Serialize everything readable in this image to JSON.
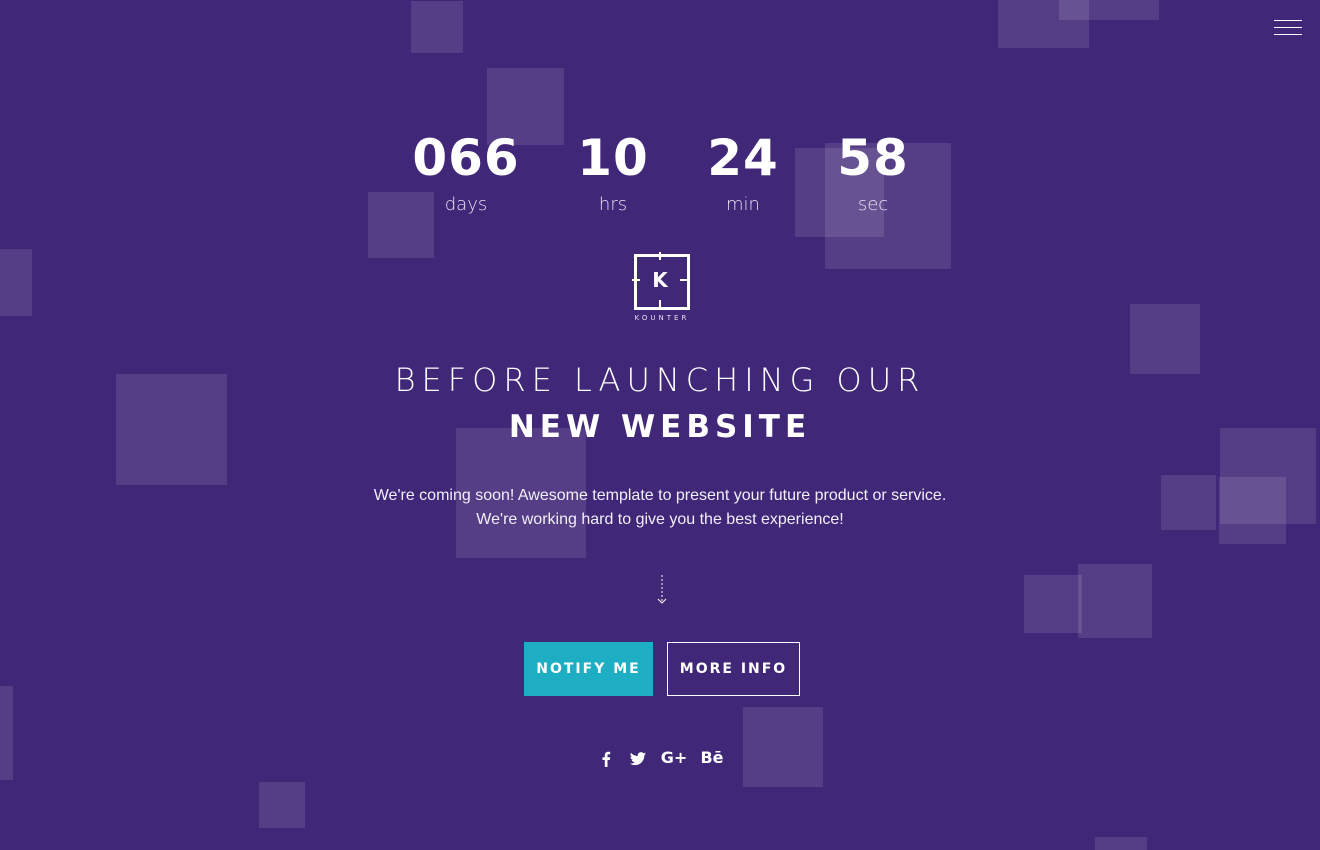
{
  "colors": {
    "background": "#402777",
    "accent": "#1eaec4",
    "text": "#ffffff"
  },
  "menu": {
    "icon": "hamburger-menu-icon"
  },
  "countdown": [
    {
      "value": "066",
      "label": "days"
    },
    {
      "value": "10",
      "label": "hrs"
    },
    {
      "value": "24",
      "label": "min"
    },
    {
      "value": "58",
      "label": "sec"
    }
  ],
  "logo": {
    "letter": "K",
    "name": "KOUNTER"
  },
  "headline": {
    "line1": "BEFORE LAUNCHING OUR",
    "line2": "NEW WEBSITE"
  },
  "description": {
    "line1": "We're coming soon! Awesome template to present your future product or service.",
    "line2": "We're working hard to give you the best experience!"
  },
  "scroll": {
    "icon": "arrow-down-icon"
  },
  "buttons": {
    "notify": "NOTIFY ME",
    "more": "MORE INFO"
  },
  "social": [
    {
      "icon": "facebook-icon",
      "glyph": "f"
    },
    {
      "icon": "twitter-icon",
      "glyph": "t"
    },
    {
      "icon": "google-plus-icon",
      "glyph": "G+"
    },
    {
      "icon": "behance-icon",
      "glyph": "Bē"
    }
  ]
}
